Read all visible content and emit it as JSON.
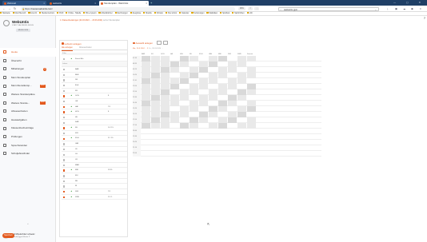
{
  "browser": {
    "tabs": [
      {
        "label": "Webmail",
        "active": false
      },
      {
        "label": "webuntis",
        "active": false
      },
      {
        "label": "Stundenplan - WebUntis",
        "active": true
      }
    ],
    "new_tab_label": "+",
    "url_prefix": "https://",
    "url_host": "neusa.webuntis.com",
    "url_rest": "/",
    "zoom_label": "90%",
    "addr_pills": [
      "☆",
      "⋮"
    ],
    "search_placeholder": "webuntis gym",
    "bookmarks": [
      "Startseite",
      "Mein Mensch",
      "Lizenz1",
      "Medienzentrum",
      "Profil",
      "Online - Tabelle",
      "BG e-lyceum",
      "Arbeitsbücher",
      "Rechnungen",
      "Zeugnisse",
      "Moodle",
      "Schulen",
      "Flex schon",
      "Kalender",
      "Vertretungen",
      "Statistiken",
      "Sportfest",
      "Nachrichten",
      "LAK"
    ]
  },
  "sidebar": {
    "brand": "WebUntis",
    "brand_sub": "STADT SALZBURG MUSIS",
    "school_badge": "MUSIS 2024",
    "items": [
      {
        "label": "Heute",
        "active": true
      },
      {
        "label": "Übersicht"
      },
      {
        "label": "Mitteilungen",
        "count": "14"
      },
      {
        "label": "Mein Stundenplan"
      },
      {
        "label": "Mein Dienstkursp...",
        "new": "NEW"
      },
      {
        "label": "Weitere Stundenpläne"
      },
      {
        "label": "Weitere Stunde...",
        "new": "NEW"
      },
      {
        "label": "Abwesenheiten"
      },
      {
        "label": "Hausaufgaben"
      },
      {
        "label": "Klassenbucheinträge"
      },
      {
        "label": "Prüfungen"
      },
      {
        "label": "Sprechstunden"
      },
      {
        "label": "Schuljahresfinder"
      }
    ],
    "collapse_icon": "«",
    "user_name": "Ingrid Mittelschüler/ schaefer",
    "user_role": "Lehrkraft@gym.Muster P",
    "user_initials": "IM"
  },
  "content": {
    "breadcrumb": "1. Klassenberatungen (24.03.2024 → 23.03.2024)",
    "breadcrumb_tail": "Lehrer Stundenplan",
    "help": "?",
    "left": {
      "header": "Lehrerin anlegen",
      "tabs": [
        "Alle anzeigen",
        "Abwesenheiten"
      ],
      "filter": "Filter",
      "rows": [
        {
          "check": "off",
          "tri": true,
          "code": "Kürzel Min",
          "val": ""
        },
        {
          "hdr": true,
          "code": "Lehrer"
        },
        {
          "check": "off",
          "code": "BAR",
          "val": ""
        },
        {
          "check": "off",
          "code": "BER",
          "val": ""
        },
        {
          "check": "off",
          "code": "DR",
          "val": ""
        },
        {
          "check": "off",
          "code": "ELA",
          "val": ""
        },
        {
          "check": "off",
          "code": "FR",
          "val": ""
        },
        {
          "check": "on",
          "tri": true,
          "code": "GOS",
          "val": "8"
        },
        {
          "check": "off",
          "code": "GR",
          "val": ""
        },
        {
          "check": "on",
          "tri": true,
          "code": "HAI",
          "val": "7/1"
        },
        {
          "check": "on",
          "tri": true,
          "code": "HOS",
          "val": "8"
        },
        {
          "check": "off",
          "code": "HU",
          "val": ""
        },
        {
          "check": "off",
          "code": "KAR",
          "val": ""
        },
        {
          "check": "on",
          "tri": true,
          "code": "KE",
          "val": "14 / 15"
        },
        {
          "check": "off",
          "code": "KIR",
          "val": ""
        },
        {
          "check": "on",
          "tri": true,
          "code": "KUH",
          "val": "11 / 15"
        },
        {
          "check": "off",
          "code": "LAN",
          "val": ""
        },
        {
          "check": "off",
          "code": "LE",
          "val": ""
        },
        {
          "check": "off",
          "code": "LH",
          "val": ""
        },
        {
          "check": "off",
          "code": "LR",
          "val": ""
        },
        {
          "check": "off",
          "code": "MAR",
          "val": ""
        },
        {
          "check": "on",
          "tri": true,
          "code": "MEI",
          "val": "11/15"
        },
        {
          "check": "off",
          "code": "MU",
          "val": ""
        },
        {
          "check": "off",
          "code": "RE",
          "val": ""
        },
        {
          "check": "off",
          "code": "RI",
          "val": ""
        },
        {
          "check": "on",
          "tri": true,
          "code": "SIM",
          "val": "7/1"
        },
        {
          "check": "on",
          "tri": true,
          "code": "SWE",
          "val": "15 / 1"
        }
      ]
    },
    "right": {
      "header": "Auswahl anlegen",
      "sub_a": "Mo., 24.3.2024 → 3",
      "sub_b": "Fr., 28.03.2024 →",
      "col_labels": [
        "BAR",
        "FLI",
        "GOS",
        "HA",
        "HSL",
        "KE",
        "KUH",
        "LAN",
        "MEI",
        "SIM",
        "SWE",
        "Summe"
      ],
      "times": [
        "07:45",
        "08:35",
        "09:25",
        "10:20",
        "11:10",
        "12:00",
        "12:50",
        "13:40",
        "14:30",
        "15:20",
        "16:10",
        "17:00",
        "17:50",
        "18:40",
        "19:30",
        "20:20",
        "21:10",
        "22:00"
      ]
    },
    "footer_button": "Speichern"
  }
}
